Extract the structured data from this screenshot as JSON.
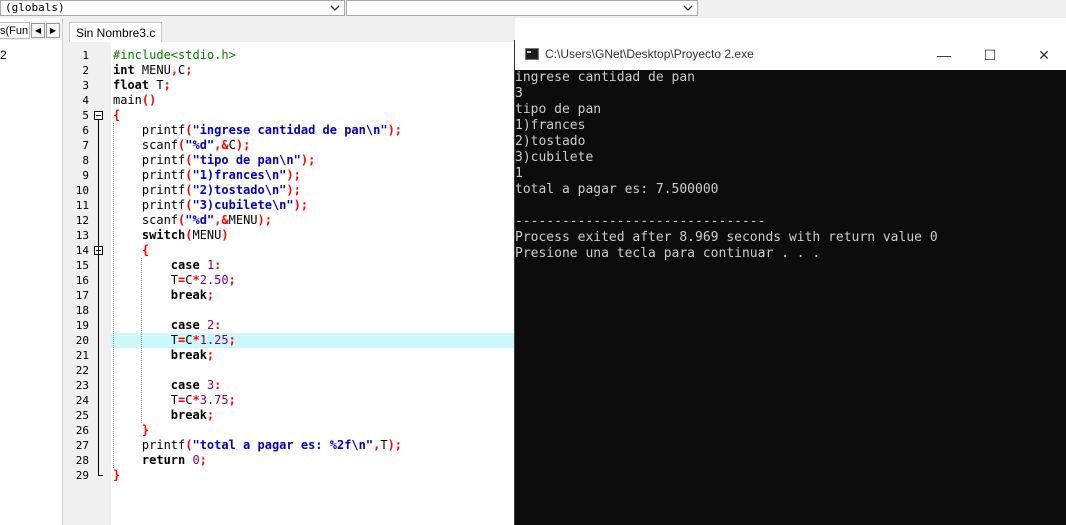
{
  "toolbar": {
    "globals_combo": "(globals)",
    "second_combo": ""
  },
  "left_pane": {
    "tab_label": "s(Fun",
    "nav_prev": "◀",
    "nav_next": "▶",
    "item": "2"
  },
  "editor": {
    "tab_label": "Sin Nombre3.c",
    "highlighted_line": 20,
    "line_numbers": [
      "1",
      "2",
      "3",
      "4",
      "5",
      "6",
      "7",
      "8",
      "9",
      "10",
      "11",
      "12",
      "13",
      "14",
      "15",
      "16",
      "17",
      "18",
      "19",
      "20",
      "21",
      "22",
      "23",
      "24",
      "25",
      "26",
      "27",
      "28",
      "29"
    ],
    "code": [
      [
        {
          "t": "#include<stdio.h>",
          "c": "pp"
        }
      ],
      [
        {
          "t": "int",
          "c": "kw"
        },
        {
          "t": " MENU",
          "c": ""
        },
        {
          "t": ",",
          "c": "sym"
        },
        {
          "t": "C",
          "c": ""
        },
        {
          "t": ";",
          "c": "sym"
        }
      ],
      [
        {
          "t": "float",
          "c": "kw"
        },
        {
          "t": " T",
          "c": ""
        },
        {
          "t": ";",
          "c": "sym"
        }
      ],
      [
        {
          "t": "main",
          "c": ""
        },
        {
          "t": "()",
          "c": "sym"
        }
      ],
      [
        {
          "t": "{",
          "c": "sym"
        }
      ],
      [
        {
          "t": "    printf",
          "c": ""
        },
        {
          "t": "(",
          "c": "sym"
        },
        {
          "t": "\"ingrese cantidad de pan\\n\"",
          "c": "str"
        },
        {
          "t": ");",
          "c": "sym"
        }
      ],
      [
        {
          "t": "    scanf",
          "c": ""
        },
        {
          "t": "(",
          "c": "sym"
        },
        {
          "t": "\"%d\"",
          "c": "str"
        },
        {
          "t": ",&",
          "c": "sym"
        },
        {
          "t": "C",
          "c": ""
        },
        {
          "t": ");",
          "c": "sym"
        }
      ],
      [
        {
          "t": "    printf",
          "c": ""
        },
        {
          "t": "(",
          "c": "sym"
        },
        {
          "t": "\"tipo de pan\\n\"",
          "c": "str"
        },
        {
          "t": ");",
          "c": "sym"
        }
      ],
      [
        {
          "t": "    printf",
          "c": ""
        },
        {
          "t": "(",
          "c": "sym"
        },
        {
          "t": "\"1)frances\\n\"",
          "c": "str"
        },
        {
          "t": ");",
          "c": "sym"
        }
      ],
      [
        {
          "t": "    printf",
          "c": ""
        },
        {
          "t": "(",
          "c": "sym"
        },
        {
          "t": "\"2)tostado\\n\"",
          "c": "str"
        },
        {
          "t": ");",
          "c": "sym"
        }
      ],
      [
        {
          "t": "    printf",
          "c": ""
        },
        {
          "t": "(",
          "c": "sym"
        },
        {
          "t": "\"3)cubilete\\n\"",
          "c": "str"
        },
        {
          "t": ");",
          "c": "sym"
        }
      ],
      [
        {
          "t": "    scanf",
          "c": ""
        },
        {
          "t": "(",
          "c": "sym"
        },
        {
          "t": "\"%d\"",
          "c": "str"
        },
        {
          "t": ",&",
          "c": "sym"
        },
        {
          "t": "MENU",
          "c": ""
        },
        {
          "t": ");",
          "c": "sym"
        }
      ],
      [
        {
          "t": "    switch",
          "c": "kw"
        },
        {
          "t": "(",
          "c": "sym"
        },
        {
          "t": "MENU",
          "c": ""
        },
        {
          "t": ")",
          "c": "sym"
        }
      ],
      [
        {
          "t": "    {",
          "c": "sym"
        }
      ],
      [
        {
          "t": "        case",
          "c": "kw"
        },
        {
          "t": " ",
          "c": ""
        },
        {
          "t": "1",
          "c": "num"
        },
        {
          "t": ":",
          "c": "sym"
        }
      ],
      [
        {
          "t": "        T",
          "c": ""
        },
        {
          "t": "=",
          "c": "sym"
        },
        {
          "t": "C",
          "c": ""
        },
        {
          "t": "*",
          "c": "sym"
        },
        {
          "t": "2.50",
          "c": "num"
        },
        {
          "t": ";",
          "c": "sym"
        }
      ],
      [
        {
          "t": "        break",
          "c": "kw"
        },
        {
          "t": ";",
          "c": "sym"
        }
      ],
      [
        {
          "t": "",
          "c": ""
        }
      ],
      [
        {
          "t": "        case",
          "c": "kw"
        },
        {
          "t": " ",
          "c": ""
        },
        {
          "t": "2",
          "c": "num"
        },
        {
          "t": ":",
          "c": "sym"
        }
      ],
      [
        {
          "t": "        T",
          "c": ""
        },
        {
          "t": "=",
          "c": "sym"
        },
        {
          "t": "C",
          "c": ""
        },
        {
          "t": "*",
          "c": "sym"
        },
        {
          "t": "1.25",
          "c": "num"
        },
        {
          "t": ";",
          "c": "sym"
        }
      ],
      [
        {
          "t": "        break",
          "c": "kw"
        },
        {
          "t": ";",
          "c": "sym"
        }
      ],
      [
        {
          "t": "",
          "c": ""
        }
      ],
      [
        {
          "t": "        case",
          "c": "kw"
        },
        {
          "t": " ",
          "c": ""
        },
        {
          "t": "3",
          "c": "num"
        },
        {
          "t": ":",
          "c": "sym"
        }
      ],
      [
        {
          "t": "        T",
          "c": ""
        },
        {
          "t": "=",
          "c": "sym"
        },
        {
          "t": "C",
          "c": ""
        },
        {
          "t": "*",
          "c": "sym"
        },
        {
          "t": "3.75",
          "c": "num"
        },
        {
          "t": ";",
          "c": "sym"
        }
      ],
      [
        {
          "t": "        break",
          "c": "kw"
        },
        {
          "t": ";",
          "c": "sym"
        }
      ],
      [
        {
          "t": "    }",
          "c": "sym"
        }
      ],
      [
        {
          "t": "    printf",
          "c": ""
        },
        {
          "t": "(",
          "c": "sym"
        },
        {
          "t": "\"total a pagar es: %2f\\n\"",
          "c": "str"
        },
        {
          "t": ",",
          "c": "sym"
        },
        {
          "t": "T",
          "c": ""
        },
        {
          "t": ");",
          "c": "sym"
        }
      ],
      [
        {
          "t": "    return",
          "c": "kw"
        },
        {
          "t": " ",
          "c": ""
        },
        {
          "t": "0",
          "c": "num"
        },
        {
          "t": ";",
          "c": "sym"
        }
      ],
      [
        {
          "t": "}",
          "c": "sym"
        }
      ]
    ]
  },
  "console": {
    "title": "C:\\Users\\GNet\\Desktop\\Proyecto 2.exe",
    "minimize": "—",
    "maximize": "☐",
    "close": "✕",
    "lines": [
      "ingrese cantidad de pan",
      "3",
      "tipo de pan",
      "1)frances",
      "2)tostado",
      "3)cubilete",
      "1",
      "total a pagar es: 7.500000",
      "",
      "--------------------------------",
      "Process exited after 8.969 seconds with return value 0",
      "Presione una tecla para continuar . . ."
    ]
  },
  "colors": {
    "highlight": "#ccf7fb",
    "preprocessor": "#008000",
    "string": "#0000c0",
    "number": "#800080",
    "symbol": "#ff0000",
    "console_bg": "#0c0c0c",
    "console_fg": "#cccccc"
  }
}
